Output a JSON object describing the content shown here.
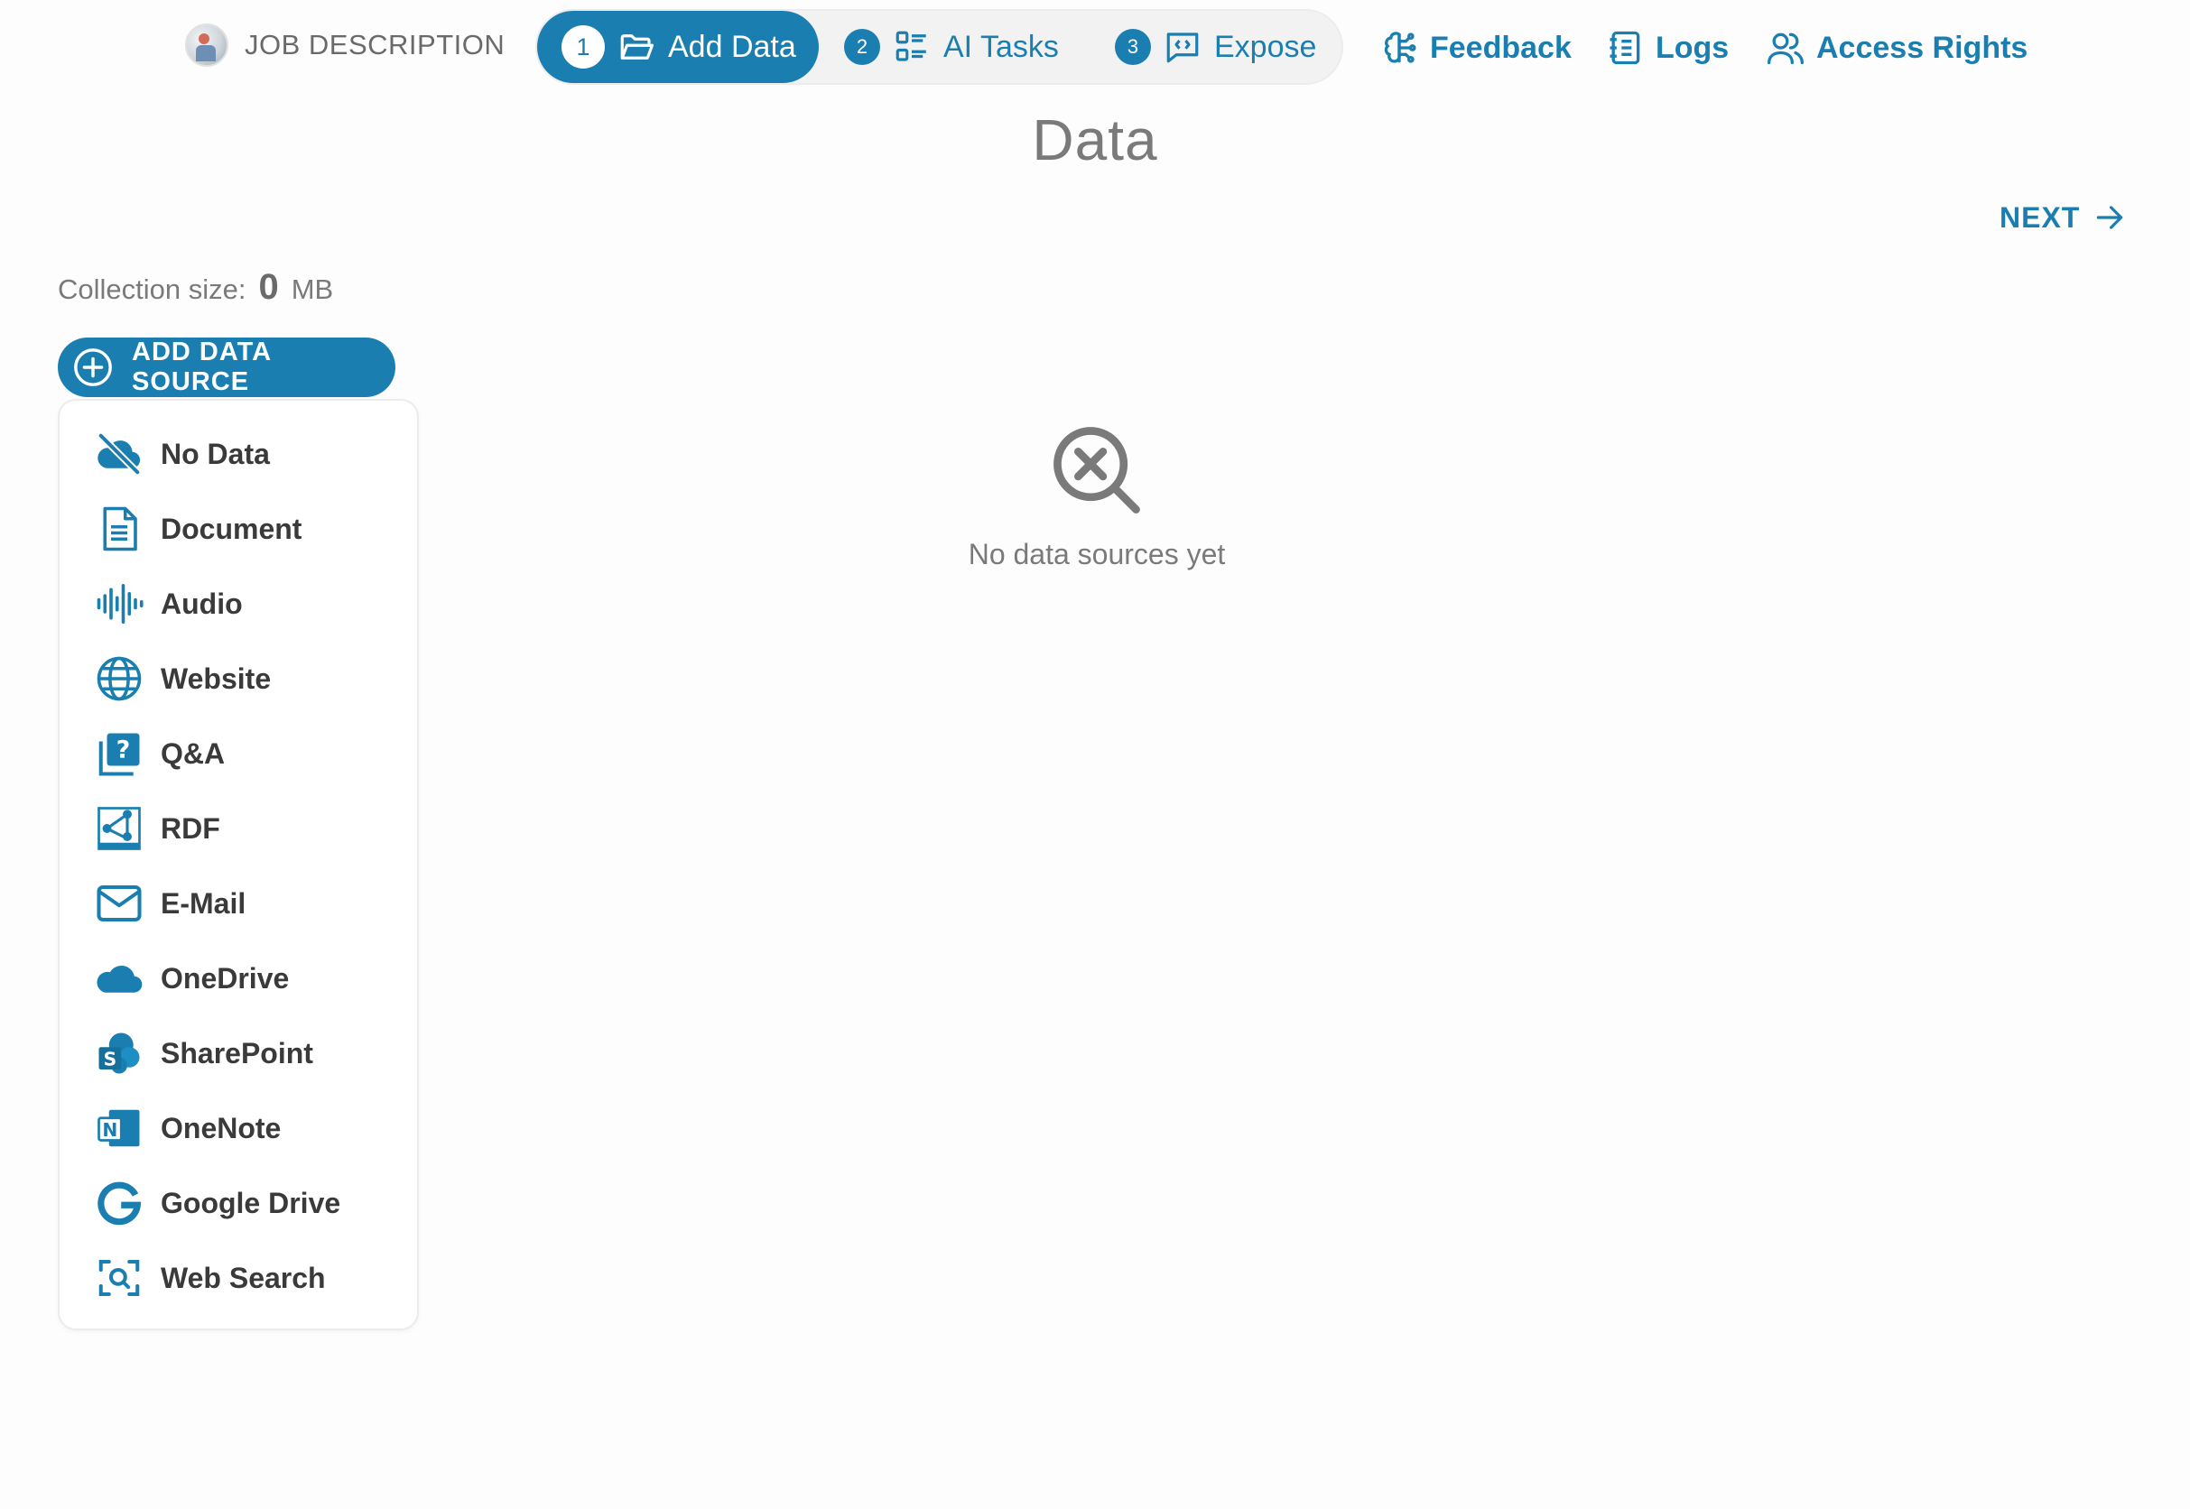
{
  "colors": {
    "accent": "#1a7fb0",
    "muted_text": "#7a7a7a",
    "menu_text": "#3a3a3a"
  },
  "header": {
    "job_description": {
      "label": "JOB DESCRIPTION",
      "icon": "job-avatar"
    },
    "steps": [
      {
        "number": "1",
        "label": "Add Data",
        "icon": "folder-open-icon",
        "active": true
      },
      {
        "number": "2",
        "label": "AI Tasks",
        "icon": "tasks-list-icon",
        "active": false
      },
      {
        "number": "3",
        "label": "Expose",
        "icon": "code-chat-icon",
        "active": false
      }
    ],
    "links": [
      {
        "label": "Feedback",
        "icon": "brain-icon"
      },
      {
        "label": "Logs",
        "icon": "notebook-icon"
      },
      {
        "label": "Access Rights",
        "icon": "users-icon"
      }
    ]
  },
  "main": {
    "title": "Data",
    "next_label": "NEXT",
    "collection": {
      "prefix": "Collection size:",
      "value": "0",
      "unit": "MB"
    },
    "add_source_label": "ADD DATA SOURCE",
    "sources": [
      {
        "label": "No Data",
        "icon": "cloud-off-icon"
      },
      {
        "label": "Document",
        "icon": "document-icon"
      },
      {
        "label": "Audio",
        "icon": "audio-waveform-icon"
      },
      {
        "label": "Website",
        "icon": "globe-icon"
      },
      {
        "label": "Q&A",
        "icon": "question-book-icon"
      },
      {
        "label": "RDF",
        "icon": "rdf-icon"
      },
      {
        "label": "E-Mail",
        "icon": "mail-icon"
      },
      {
        "label": "OneDrive",
        "icon": "onedrive-icon"
      },
      {
        "label": "SharePoint",
        "icon": "sharepoint-icon"
      },
      {
        "label": "OneNote",
        "icon": "onenote-icon"
      },
      {
        "label": "Google Drive",
        "icon": "google-icon"
      },
      {
        "label": "Web Search",
        "icon": "web-search-icon"
      }
    ],
    "empty_state": {
      "text": "No data sources yet",
      "icon": "search-x-icon"
    }
  }
}
